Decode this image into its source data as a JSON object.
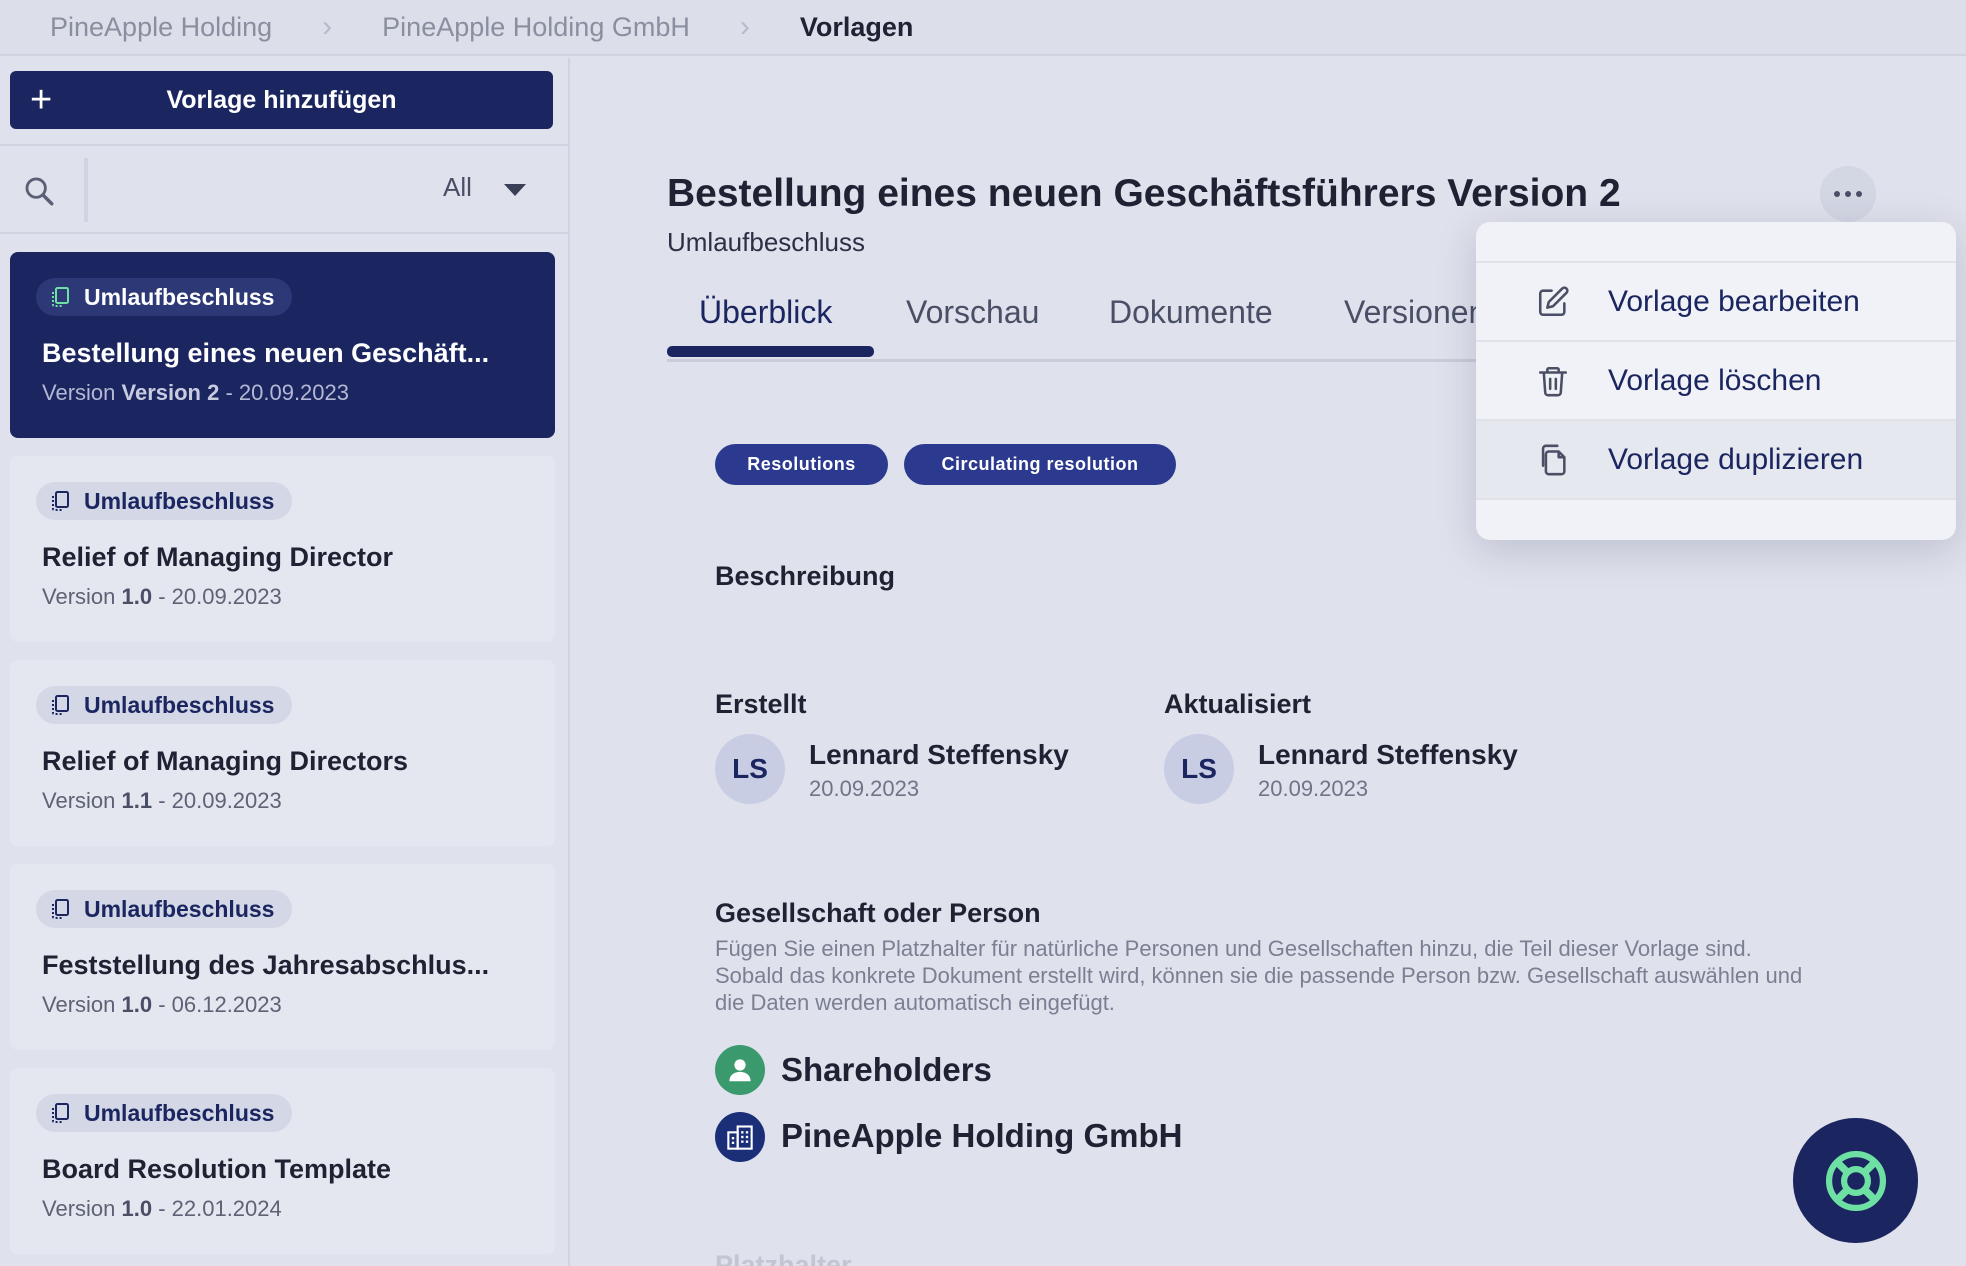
{
  "breadcrumb": {
    "items": [
      "PineApple Holding",
      "PineApple Holding GmbH"
    ],
    "current": "Vorlagen"
  },
  "sidebar": {
    "add_label": "Vorlage hinzufügen",
    "filter_value": "All",
    "cards": [
      {
        "tag": "Umlaufbeschluss",
        "title": "Bestellung eines neuen Geschäft...",
        "version_prefix": "Version ",
        "version": "Version 2",
        "date": " - 20.09.2023"
      },
      {
        "tag": "Umlaufbeschluss",
        "title": "Relief of Managing Director",
        "version_prefix": "Version ",
        "version": "1.0",
        "date": " - 20.09.2023"
      },
      {
        "tag": "Umlaufbeschluss",
        "title": "Relief of Managing Directors",
        "version_prefix": "Version ",
        "version": "1.1",
        "date": " - 20.09.2023"
      },
      {
        "tag": "Umlaufbeschluss",
        "title": "Feststellung des Jahresabschlus...",
        "version_prefix": "Version ",
        "version": "1.0",
        "date": " - 06.12.2023"
      },
      {
        "tag": "Umlaufbeschluss",
        "title": "Board Resolution Template",
        "version_prefix": "Version ",
        "version": "1.0",
        "date": " - 22.01.2024"
      }
    ]
  },
  "main": {
    "title": "Bestellung eines neuen Geschäftsführers Version 2",
    "subtitle": "Umlaufbeschluss",
    "tabs": [
      "Überblick",
      "Vorschau",
      "Dokumente",
      "Versionen"
    ],
    "chips": [
      "Resolutions",
      "Circulating resolution"
    ],
    "description_label": "Beschreibung",
    "created": {
      "label": "Erstellt",
      "initials": "LS",
      "name": "Lennard Steffensky",
      "date": "20.09.2023"
    },
    "updated": {
      "label": "Aktualisiert",
      "initials": "LS",
      "name": "Lennard Steffensky",
      "date": "20.09.2023"
    },
    "entity_section": {
      "label": "Gesellschaft oder Person",
      "description": "Fügen Sie einen Platzhalter für natürliche Personen und Gesellschaften hinzu, die Teil dieser Vorlage sind. Sobald das konkrete Dokument erstellt wird, können sie die passende Person bzw. Gesellschaft auswählen und die Daten werden automatisch eingefügt.",
      "entities": [
        {
          "name": "Shareholders",
          "icon": "person-icon",
          "color": "#3a9a6e"
        },
        {
          "name": "PineApple Holding GmbH",
          "icon": "building-icon",
          "color": "#1b2e78"
        }
      ]
    },
    "next_section_label": "Platzhalter"
  },
  "menu": {
    "items": [
      {
        "label": "Vorlage bearbeiten",
        "icon": "edit-icon"
      },
      {
        "label": "Vorlage löschen",
        "icon": "trash-icon"
      },
      {
        "label": "Vorlage duplizieren",
        "icon": "copy-icon"
      }
    ]
  },
  "colors": {
    "primary": "#1b2660",
    "chip": "#2b3a8e",
    "background": "#dfe1ec",
    "accent_green": "#6fe0a3"
  }
}
